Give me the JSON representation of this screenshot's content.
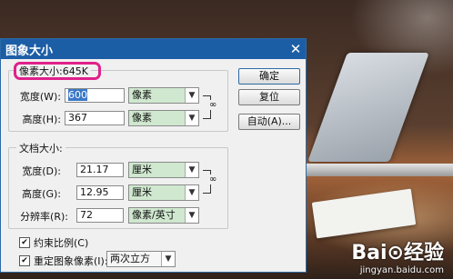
{
  "window": {
    "title": "图象大小"
  },
  "pixel_dimensions": {
    "label": "像素大小:645K",
    "width_label": "宽度(W):",
    "width_value": "600",
    "width_unit": "像素",
    "height_label": "高度(H):",
    "height_value": "367",
    "height_unit": "像素"
  },
  "document_size": {
    "label": "文档大小:",
    "width_label": "宽度(D):",
    "width_value": "21.17",
    "width_unit": "厘米",
    "height_label": "高度(G):",
    "height_value": "12.95",
    "height_unit": "厘米",
    "resolution_label": "分辨率(R):",
    "resolution_value": "72",
    "resolution_unit": "像素/英寸"
  },
  "buttons": {
    "ok": "确定",
    "reset": "复位",
    "auto": "自动(A)..."
  },
  "options": {
    "constrain_label": "约束比例(C)",
    "constrain_checked": true,
    "resample_label": "重定图象像素(I):",
    "resample_checked": true,
    "resample_method": "两次立方"
  },
  "watermark": {
    "brand": "Bai⊙经验",
    "url": "jingyan.baidu.com"
  },
  "colors": {
    "titlebar": "#1c5ea6",
    "highlight": "#e0218a",
    "select_bg": "#cfe8cf"
  }
}
